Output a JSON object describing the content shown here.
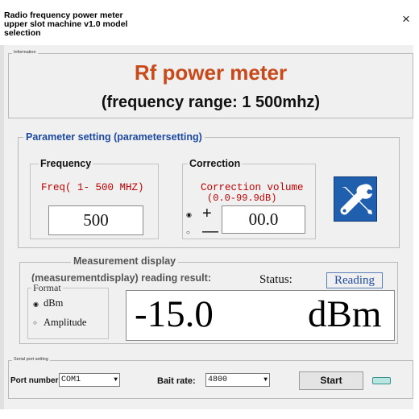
{
  "window": {
    "title": "Radio frequency power meter upper slot machine v1.0 model selection",
    "close_glyph": "×"
  },
  "information": {
    "legend": "Information",
    "main_title": "Rf power meter",
    "frequency_range": "(frequency range: 1 500mhz)"
  },
  "parameter": {
    "legend": "Parameter setting (parametersetting)",
    "frequency": {
      "legend": "Frequency",
      "range_label": "Freq( 1- 500 MHZ)",
      "value": "500"
    },
    "correction": {
      "legend": "Correction",
      "label_line1": "Correction volume",
      "label_line2": "(0.0-99.9dB)",
      "plus_sign": "+",
      "minus_sign": "—",
      "selected_sign": "+",
      "value": "00.0"
    },
    "tools_icon": "wrench-screwdriver-icon"
  },
  "measurement": {
    "legend": "Measurement display",
    "subtitle": "(measurementdisplay) reading result:",
    "status_label": "Status:",
    "status_value": "Reading",
    "format": {
      "legend": "Format",
      "options": [
        "dBm",
        "Amplitude"
      ],
      "selected": "dBm"
    },
    "reading": {
      "value": "-15.0",
      "unit": "dBm"
    }
  },
  "serial": {
    "legend": "Serial port setting",
    "port_label": "Port number:",
    "port_value": "COM1",
    "baud_label": "Bait rate:",
    "baud_value": "4800",
    "start_label": "Start"
  },
  "colors": {
    "title_accent": "#c84a1a",
    "legend_blue": "#1d4aa0",
    "range_red": "#c00000",
    "tool_button": "#1f5fae",
    "led": "#b9e6e0"
  }
}
